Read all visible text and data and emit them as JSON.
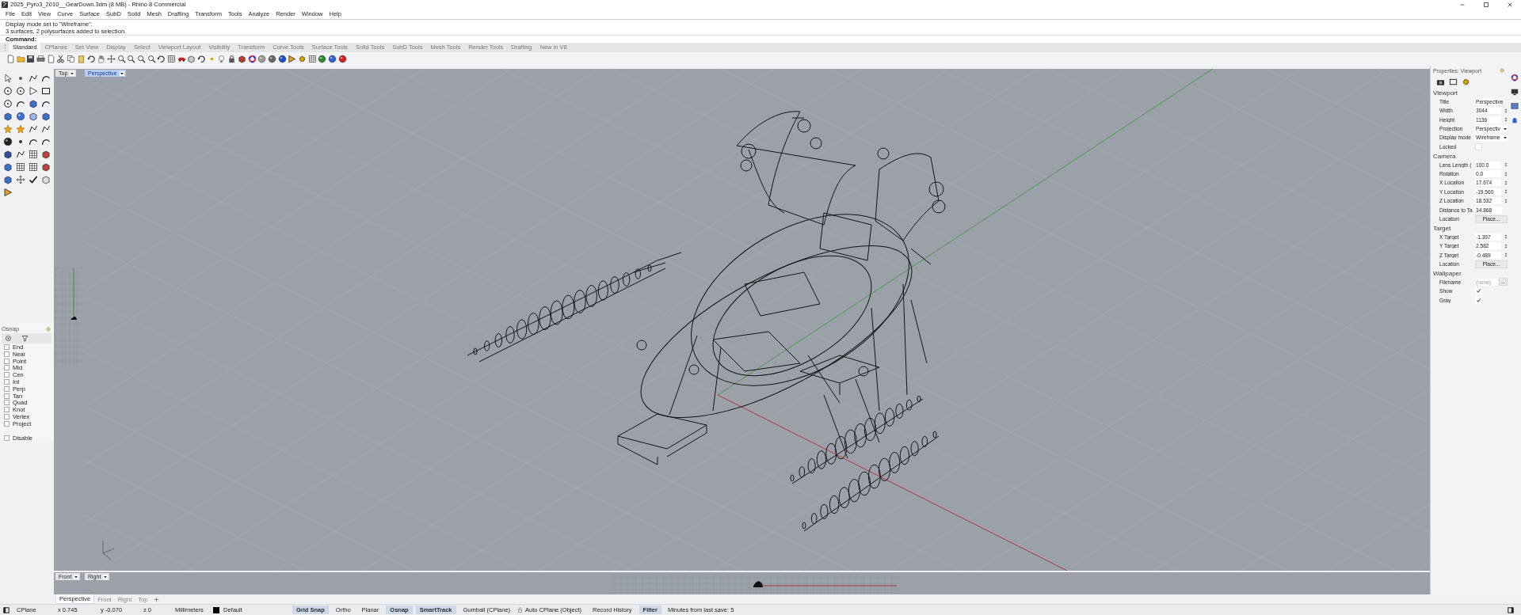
{
  "window": {
    "title": "2025_Pyro3_2010__GearDown.3dm (8 MB) - Rhino 8 Commercial"
  },
  "menu": [
    "File",
    "Edit",
    "View",
    "Curve",
    "Surface",
    "SubD",
    "Solid",
    "Mesh",
    "Drafting",
    "Transform",
    "Tools",
    "Analyze",
    "Render",
    "Window",
    "Help"
  ],
  "command_history": [
    "Display mode set to \"Wireframe\".",
    "3 surfaces, 2 polysurfaces added to selection."
  ],
  "command_prompt": {
    "label": "Command:"
  },
  "toolbar_tabs": [
    {
      "label": "Standard",
      "selected": true
    },
    {
      "label": "CPlanes",
      "selected": false
    },
    {
      "label": "Set View",
      "selected": false
    },
    {
      "label": "Display",
      "selected": false
    },
    {
      "label": "Select",
      "selected": false
    },
    {
      "label": "Viewport Layout",
      "selected": false
    },
    {
      "label": "Visibility",
      "selected": false
    },
    {
      "label": "Transform",
      "selected": false
    },
    {
      "label": "Curve Tools",
      "selected": false
    },
    {
      "label": "Surface Tools",
      "selected": false
    },
    {
      "label": "Solid Tools",
      "selected": false
    },
    {
      "label": "SubD Tools",
      "selected": false
    },
    {
      "label": "Mesh Tools",
      "selected": false
    },
    {
      "label": "Render Tools",
      "selected": false
    },
    {
      "label": "Drafting",
      "selected": false
    },
    {
      "label": "New in V8",
      "selected": false
    }
  ],
  "viewports": {
    "top": {
      "title": "Top",
      "active": false
    },
    "perspective": {
      "title": "Perspective",
      "active": true
    },
    "front": {
      "title": "Front",
      "active": false
    },
    "right": {
      "title": "Right",
      "active": false
    }
  },
  "osnap": {
    "title": "Osnap",
    "items": [
      {
        "label": "End",
        "checked": false
      },
      {
        "label": "Near",
        "checked": false
      },
      {
        "label": "Point",
        "checked": false
      },
      {
        "label": "Mid",
        "checked": false
      },
      {
        "label": "Cen",
        "checked": false
      },
      {
        "label": "Int",
        "checked": false
      },
      {
        "label": "Perp",
        "checked": false
      },
      {
        "label": "Tan",
        "checked": false
      },
      {
        "label": "Quad",
        "checked": false
      },
      {
        "label": "Knot",
        "checked": false
      },
      {
        "label": "Vertex",
        "checked": false
      },
      {
        "label": "Project",
        "checked": false
      }
    ],
    "disable": {
      "label": "Disable",
      "checked": false
    }
  },
  "properties": {
    "title": "Properties: Viewport",
    "sections": [
      {
        "title": "Viewport",
        "rows": [
          {
            "label": "Title",
            "kind": "text",
            "value": "Perspective"
          },
          {
            "label": "Width",
            "kind": "spin",
            "value": "3044"
          },
          {
            "label": "Height",
            "kind": "spin",
            "value": "1136"
          },
          {
            "label": "Projection",
            "kind": "dropdown",
            "value": "Perspectiv"
          },
          {
            "label": "Display mode",
            "kind": "dropdown",
            "value": "Wireframe"
          },
          {
            "label": "Locked",
            "kind": "checkbox",
            "checked": false
          }
        ]
      },
      {
        "title": "Camera",
        "rows": [
          {
            "label": "Lens Length (",
            "kind": "spin",
            "value": "100.0"
          },
          {
            "label": "Rotation",
            "kind": "spin",
            "value": "0.0"
          },
          {
            "label": "X Location",
            "kind": "spin",
            "value": "17.674"
          },
          {
            "label": "Y Location",
            "kind": "spin",
            "value": "-19.560"
          },
          {
            "label": "Z Location",
            "kind": "spin",
            "value": "18.532"
          },
          {
            "label": "Distance to Ta",
            "kind": "text",
            "value": "34.868"
          },
          {
            "label": "Location",
            "kind": "button",
            "value": "Place..."
          }
        ]
      },
      {
        "title": "Target",
        "rows": [
          {
            "label": "X Target",
            "kind": "spin",
            "value": "-1.397"
          },
          {
            "label": "Y Target",
            "kind": "spin",
            "value": "2.582"
          },
          {
            "label": "Z Target",
            "kind": "spin",
            "value": "-0.489"
          },
          {
            "label": "Location",
            "kind": "button",
            "value": "Place..."
          }
        ]
      },
      {
        "title": "Wallpaper",
        "rows": [
          {
            "label": "Filename",
            "kind": "file",
            "placeholder": "(none)",
            "button": "..."
          },
          {
            "label": "Show",
            "kind": "checkbox",
            "checked": true
          },
          {
            "label": "Gray",
            "kind": "checkbox",
            "checked": true
          }
        ]
      }
    ]
  },
  "viewport_tabs": [
    {
      "label": "Perspective",
      "selected": true
    },
    {
      "label": "Front",
      "selected": false
    },
    {
      "label": "Right",
      "selected": false
    },
    {
      "label": "Top",
      "selected": false
    }
  ],
  "status_bar": {
    "cplane": "CPlane",
    "x": "x 0.745",
    "y": "y -0.070",
    "z": "z 0",
    "units": "Millimeters",
    "layer": "Default",
    "toggles": [
      {
        "label": "Grid Snap",
        "on": true
      },
      {
        "label": "Ortho",
        "on": false
      },
      {
        "label": "Planar",
        "on": false
      },
      {
        "label": "Osnap",
        "on": true
      },
      {
        "label": "SmartTrack",
        "on": true
      },
      {
        "label": "Gumball (CPlane)",
        "on": false
      },
      {
        "label": "Auto CPlane (Object)",
        "on": false,
        "locked": true
      },
      {
        "label": "Record History",
        "on": false
      },
      {
        "label": "Filter",
        "on": true
      }
    ],
    "save_info": "Minutes from last save: 5"
  }
}
